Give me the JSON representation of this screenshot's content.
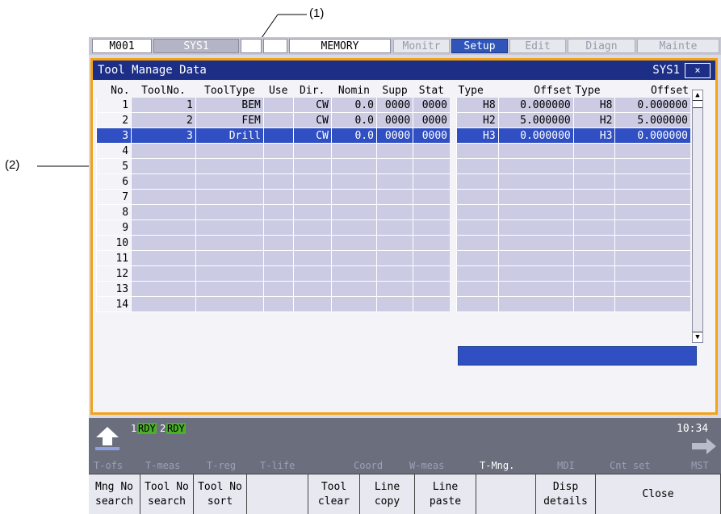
{
  "callouts": {
    "c1": "(1)",
    "c2": "(2)"
  },
  "topbar": {
    "program": "M001",
    "system": "SYS1",
    "mode": "MEMORY",
    "tabs": [
      "Monitr",
      "Setup",
      "Edit",
      "Diagn",
      "Mainte"
    ],
    "active_tab": "Setup"
  },
  "window": {
    "title": "Tool Manage Data",
    "system": "SYS1",
    "close_glyph": "×"
  },
  "left_table": {
    "headers": [
      "No.",
      "ToolNo.",
      "ToolType",
      "Use",
      "Dir.",
      "Nomin",
      "Supp",
      "Stat"
    ],
    "rows": [
      {
        "no": "1",
        "toolno": "1",
        "type": "BEM",
        "use": "",
        "dir": "CW",
        "nomin": "0.0",
        "supp": "0000",
        "stat": "0000"
      },
      {
        "no": "2",
        "toolno": "2",
        "type": "FEM",
        "use": "",
        "dir": "CW",
        "nomin": "0.0",
        "supp": "0000",
        "stat": "0000"
      },
      {
        "no": "3",
        "toolno": "3",
        "type": "Drill",
        "use": "",
        "dir": "CW",
        "nomin": "0.0",
        "supp": "0000",
        "stat": "0000"
      },
      {
        "no": "4",
        "toolno": "",
        "type": "",
        "use": "",
        "dir": "",
        "nomin": "",
        "supp": "",
        "stat": ""
      },
      {
        "no": "5",
        "toolno": "",
        "type": "",
        "use": "",
        "dir": "",
        "nomin": "",
        "supp": "",
        "stat": ""
      },
      {
        "no": "6",
        "toolno": "",
        "type": "",
        "use": "",
        "dir": "",
        "nomin": "",
        "supp": "",
        "stat": ""
      },
      {
        "no": "7",
        "toolno": "",
        "type": "",
        "use": "",
        "dir": "",
        "nomin": "",
        "supp": "",
        "stat": ""
      },
      {
        "no": "8",
        "toolno": "",
        "type": "",
        "use": "",
        "dir": "",
        "nomin": "",
        "supp": "",
        "stat": ""
      },
      {
        "no": "9",
        "toolno": "",
        "type": "",
        "use": "",
        "dir": "",
        "nomin": "",
        "supp": "",
        "stat": ""
      },
      {
        "no": "10",
        "toolno": "",
        "type": "",
        "use": "",
        "dir": "",
        "nomin": "",
        "supp": "",
        "stat": ""
      },
      {
        "no": "11",
        "toolno": "",
        "type": "",
        "use": "",
        "dir": "",
        "nomin": "",
        "supp": "",
        "stat": ""
      },
      {
        "no": "12",
        "toolno": "",
        "type": "",
        "use": "",
        "dir": "",
        "nomin": "",
        "supp": "",
        "stat": ""
      },
      {
        "no": "13",
        "toolno": "",
        "type": "",
        "use": "",
        "dir": "",
        "nomin": "",
        "supp": "",
        "stat": ""
      },
      {
        "no": "14",
        "toolno": "",
        "type": "",
        "use": "",
        "dir": "",
        "nomin": "",
        "supp": "",
        "stat": ""
      }
    ]
  },
  "right_table": {
    "headers": [
      "Type",
      "Offset",
      "Type",
      "Offset"
    ],
    "rows": [
      {
        "t1": "H8",
        "o1": "0.000000",
        "t2": "H8",
        "o2": "0.000000"
      },
      {
        "t1": "H2",
        "o1": "5.000000",
        "t2": "H2",
        "o2": "5.000000"
      },
      {
        "t1": "H3",
        "o1": "0.000000",
        "t2": "H3",
        "o2": "0.000000"
      },
      {
        "t1": "",
        "o1": "",
        "t2": "",
        "o2": ""
      },
      {
        "t1": "",
        "o1": "",
        "t2": "",
        "o2": ""
      },
      {
        "t1": "",
        "o1": "",
        "t2": "",
        "o2": ""
      },
      {
        "t1": "",
        "o1": "",
        "t2": "",
        "o2": ""
      },
      {
        "t1": "",
        "o1": "",
        "t2": "",
        "o2": ""
      },
      {
        "t1": "",
        "o1": "",
        "t2": "",
        "o2": ""
      },
      {
        "t1": "",
        "o1": "",
        "t2": "",
        "o2": ""
      },
      {
        "t1": "",
        "o1": "",
        "t2": "",
        "o2": ""
      },
      {
        "t1": "",
        "o1": "",
        "t2": "",
        "o2": ""
      },
      {
        "t1": "",
        "o1": "",
        "t2": "",
        "o2": ""
      },
      {
        "t1": "",
        "o1": "",
        "t2": "",
        "o2": ""
      }
    ]
  },
  "selected_row": 3,
  "status": {
    "rdy1_num": "1",
    "rdy1": "RDY",
    "rdy2_num": "2",
    "rdy2": "RDY",
    "time": "10:34"
  },
  "menu_labels": [
    "T-ofs",
    "T-meas",
    "T-reg",
    "T-life",
    "Coord",
    "W-meas",
    "T-Mng.",
    "MDI",
    "Cnt set",
    "MST"
  ],
  "active_menu": "T-Mng.",
  "softkeys": [
    {
      "l1": "Mng No",
      "l2": "search"
    },
    {
      "l1": "Tool No",
      "l2": "search"
    },
    {
      "l1": "Tool No",
      "l2": "sort"
    },
    {
      "l1": "",
      "l2": ""
    },
    {
      "l1": "Tool",
      "l2": "clear"
    },
    {
      "l1": "Line",
      "l2": "copy"
    },
    {
      "l1": "Line",
      "l2": "paste"
    },
    {
      "l1": "",
      "l2": ""
    },
    {
      "l1": "Disp",
      "l2": "details"
    },
    {
      "l1": "Close",
      "l2": ""
    }
  ],
  "colors": {
    "accent": "#2f4fc2",
    "title": "#1c2e86",
    "frame": "#f2a316",
    "rdy": "#4caf2a"
  }
}
